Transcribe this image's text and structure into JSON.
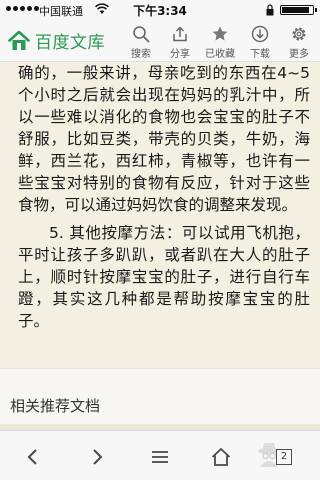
{
  "status_bar": {
    "carrier": "中国联通",
    "time": "下午3:34",
    "battery_level": 0.9
  },
  "header": {
    "logo_text": "百度文库",
    "tools": [
      {
        "label": "搜索",
        "icon": "search-icon"
      },
      {
        "label": "分享",
        "icon": "share-icon"
      },
      {
        "label": "已收藏",
        "icon": "star-icon"
      },
      {
        "label": "下载",
        "icon": "download-icon"
      },
      {
        "label": "更多",
        "icon": "gear-icon"
      }
    ]
  },
  "article": {
    "paragraph1": "确的，一般来讲，母亲吃到的东西在4~5个小时之后就会出现在妈妈的乳汁中，所以一些难以消化的食物也会宝宝的肚子不舒服，比如豆类，带壳的贝类，牛奶，海鲜，西兰花，西红柿，青椒等，也许有一些宝宝对特别的食物有反应，针对于这些食物，可以通过妈妈饮食的调整来发现。",
    "paragraph2": "5. 其他按摩方法：可以试用飞机抱，平时让孩子多趴趴，或者趴在大人的肚子上，顺时针按摩宝宝的肚子，进行自行车蹬，其实这几种都是帮助按摩宝宝的肚子。"
  },
  "related": {
    "title": "相关推荐文档"
  },
  "browser_toolbar": {
    "tabs_count": "2",
    "accent": "#2a9a55"
  }
}
